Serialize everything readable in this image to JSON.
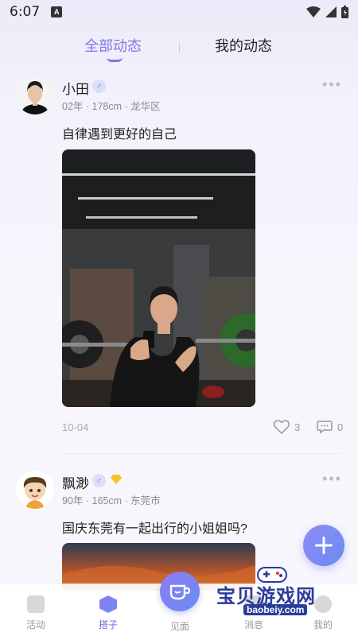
{
  "status_bar": {
    "time": "6:07",
    "notif_letter": "A"
  },
  "tabs": {
    "all": "全部动态",
    "mine": "我的动态"
  },
  "posts": [
    {
      "name": "小田",
      "gender": "♂",
      "meta": "02年 · 178cm · 龙华区",
      "content": "自律遇到更好的自己",
      "date": "10-04",
      "likes": "3",
      "comments": "0"
    },
    {
      "name": "飘渺",
      "gender": "♂",
      "meta": "90年 · 165cm · 东莞市",
      "content": "国庆东莞有一起出行的小姐姐吗?"
    }
  ],
  "nav": {
    "activity": "活动",
    "partner": "搭子",
    "meet": "见面",
    "message": "消息",
    "me": "我的"
  },
  "watermark": {
    "text": "宝贝游戏网",
    "url": "baobeiy.com"
  },
  "colors": {
    "accent": "#7b78e6",
    "fab": "#7a8cf3"
  }
}
